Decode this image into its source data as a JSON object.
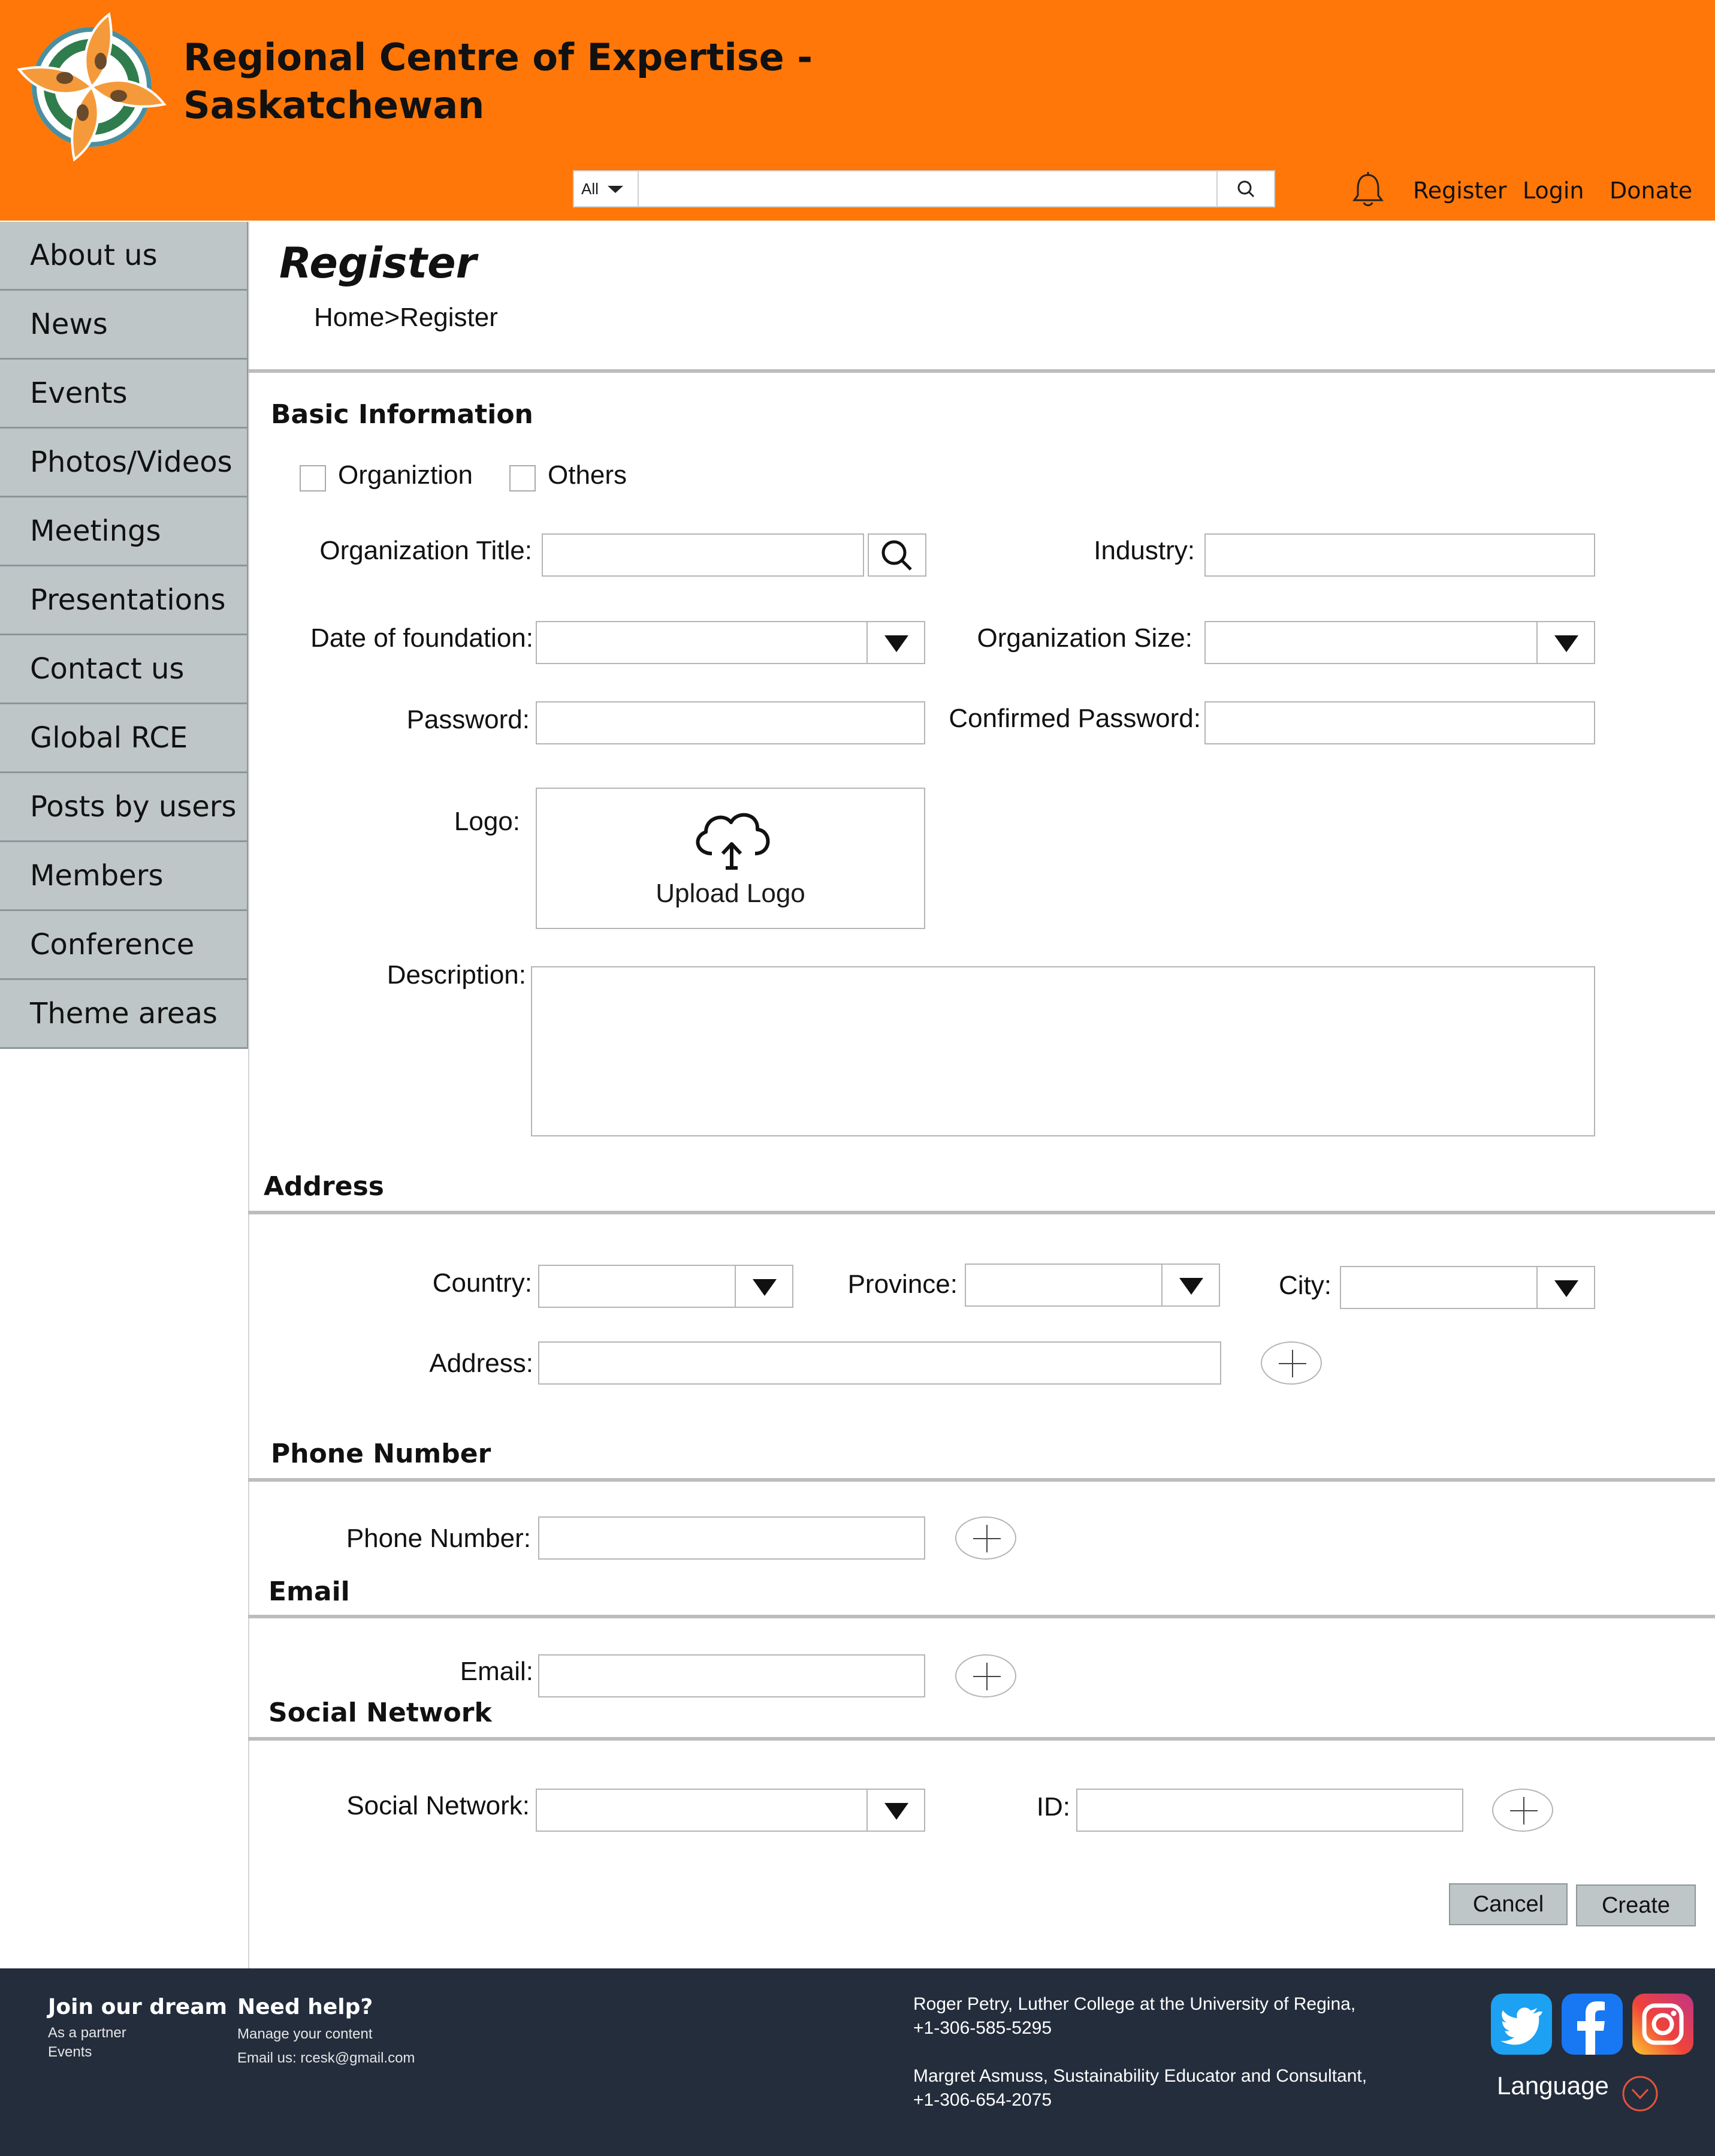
{
  "header": {
    "title_line1": "Regional Centre of Expertise -",
    "title_line2": "Saskatchewan",
    "search_scope": "All",
    "search_value": "",
    "links": {
      "register": "Register",
      "login": "Login",
      "donate": "Donate"
    }
  },
  "sidebar": {
    "items": [
      {
        "label": "About us"
      },
      {
        "label": "News"
      },
      {
        "label": "Events"
      },
      {
        "label": "Photos/Videos"
      },
      {
        "label": "Meetings"
      },
      {
        "label": "Presentations"
      },
      {
        "label": "Contact us"
      },
      {
        "label": "Global RCE"
      },
      {
        "label": "Posts by users"
      },
      {
        "label": "Members"
      },
      {
        "label": "Conference"
      },
      {
        "label": "Theme areas"
      }
    ]
  },
  "page": {
    "title": "Register",
    "breadcrumb": "Home>Register"
  },
  "basic": {
    "heading": "Basic Information",
    "type_organization": "Organiztion",
    "type_others": "Others",
    "org_title_label": "Organization Title:",
    "industry_label": "Industry:",
    "foundation_label": "Date of foundation:",
    "size_label": "Organization Size:",
    "password_label": "Password:",
    "confirm_label": "Confirmed Password:",
    "logo_label": "Logo:",
    "upload_label": "Upload Logo",
    "description_label": "Description:"
  },
  "address": {
    "heading": "Address",
    "country_label": "Country:",
    "province_label": "Province:",
    "city_label": "City:",
    "address_label": "Address:"
  },
  "phone": {
    "heading": "Phone Number",
    "label": "Phone Number:"
  },
  "email": {
    "heading": "Email",
    "label": "Email:"
  },
  "social": {
    "heading": "Social Network",
    "network_label": "Social Network:",
    "id_label": "ID:"
  },
  "actions": {
    "cancel": "Cancel",
    "create": "Create"
  },
  "footer": {
    "join_heading": "Join our dream",
    "join_partner": "As a partner",
    "join_events": "Events",
    "help_heading": "Need help?",
    "help_manage": "Manage your content",
    "help_email": "Email us: rcesk@gmail.com",
    "contact1_name": "Roger Petry, Luther College at the University of Regina,",
    "contact1_phone": "+1-306-585-5295",
    "contact2_name": "Margret Asmuss, Sustainability Educator and Consultant,",
    "contact2_phone": "+1-306-654-2075",
    "language": "Language",
    "icons": [
      "twitter-icon",
      "facebook-icon",
      "instagram-icon"
    ]
  },
  "colors": {
    "header_bg": "#ff7708",
    "sidebar_bg": "#bfc6c8",
    "footer_bg": "#242d3c",
    "twitter": "#1da1f2",
    "facebook": "#1877f2"
  }
}
